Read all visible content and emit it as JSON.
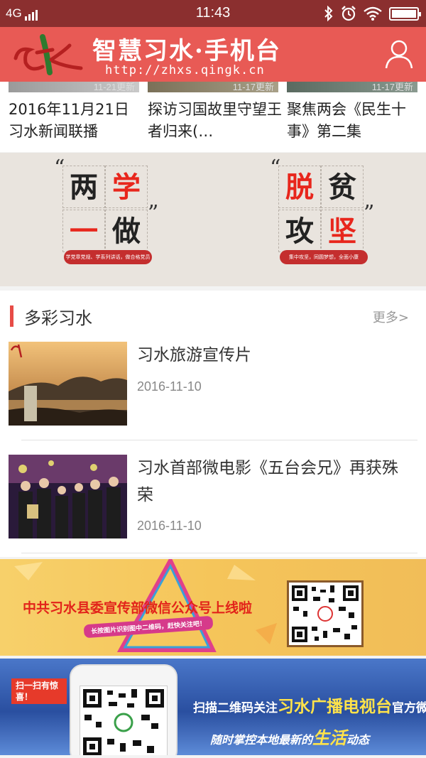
{
  "status_bar": {
    "network": "4G",
    "time": "11:43"
  },
  "header": {
    "title": "智慧习水·手机台",
    "url": "http://zhxs.qingk.cn"
  },
  "news_strip": [
    {
      "title": "2016年11月21日习水新闻联播",
      "badge": "11-21更新"
    },
    {
      "title": "探访习国故里守望王者归来(…",
      "badge": "11-17更新"
    },
    {
      "title": "聚焦两会《民生十事》第二集",
      "badge": "11-17更新"
    }
  ],
  "campaign_banners": [
    {
      "chars": [
        "两",
        "学",
        "一",
        "做"
      ],
      "slogan": "学党章党规、学系列讲话，做合格党员"
    },
    {
      "chars": [
        "脱",
        "贫",
        "攻",
        "坚"
      ],
      "slogan": "集中攻坚，同圆梦想，全面小康"
    }
  ],
  "section": {
    "title": "多彩习水",
    "more": "更多>",
    "items": [
      {
        "title": "习水旅游宣传片",
        "date": "2016-11-10"
      },
      {
        "title": "习水首部微电影《五台会兄》再获殊荣",
        "date": "2016-11-10"
      }
    ]
  },
  "promos": {
    "wechat_banner": {
      "headline": "中共习水县委宣传部微信公众号上线啦",
      "sub": "长按图片识别图中二维码，赶快关注吧！"
    },
    "tv_banner": {
      "tag": "扫一扫有惊喜！",
      "headline_a": "扫描二维码关注",
      "headline_b": "习水广播电视台",
      "headline_c": "官方微信",
      "sub_a": "随时掌控本地最新的",
      "sub_b": "生活",
      "sub_c": "动态"
    }
  },
  "colors": {
    "status_bar": "#8b2f2f",
    "header": "#e85a55",
    "accent": "#e74b46"
  }
}
